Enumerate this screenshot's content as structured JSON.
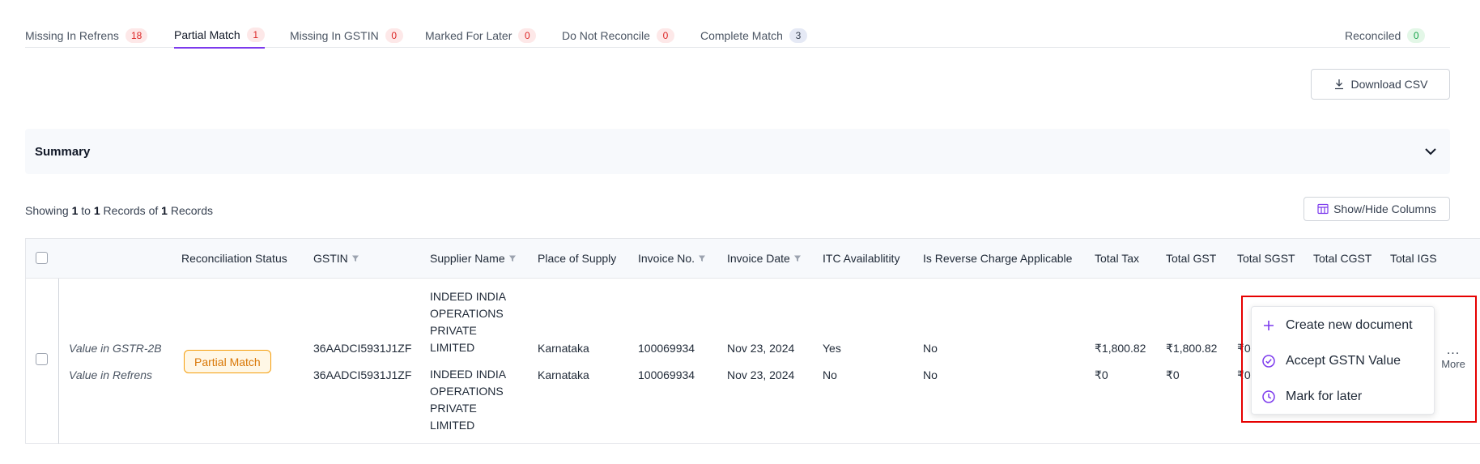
{
  "tabs": [
    {
      "label": "Missing In Refrens",
      "count": "18"
    },
    {
      "label": "Partial Match",
      "count": "1"
    },
    {
      "label": "Missing In GSTIN",
      "count": "0"
    },
    {
      "label": "Marked For Later",
      "count": "0"
    },
    {
      "label": "Do Not Reconcile",
      "count": "0"
    },
    {
      "label": "Complete Match",
      "count": "3"
    }
  ],
  "reconciled": {
    "label": "Reconciled",
    "count": "0"
  },
  "download_label": "Download CSV",
  "summary_title": "Summary",
  "showing": {
    "prefix": "Showing",
    "from": "1",
    "to_word": "to",
    "to": "1",
    "records_word": "Records",
    "of_word": "of",
    "total": "1",
    "records_word2": "Records"
  },
  "show_hide_label": "Show/Hide Columns",
  "columns": {
    "reconciliation_status": "Reconciliation Status",
    "gstin": "GSTIN",
    "supplier_name": "Supplier Name",
    "place_of_supply": "Place of Supply",
    "invoice_no": "Invoice No.",
    "invoice_date": "Invoice Date",
    "itc": "ITC Availablitity",
    "reverse_charge": "Is Reverse Charge Applicable",
    "total_tax": "Total Tax",
    "total_gst": "Total GST",
    "total_sgst": "Total SGST",
    "total_cgst": "Total CGST",
    "total_igst": "Total IGS"
  },
  "row": {
    "status": "Partial Match",
    "gstr": {
      "label": "Value in GSTR-2B",
      "gstin": "36AADCI5931J1ZF",
      "supplier_lines": [
        "INDEED INDIA",
        "OPERATIONS",
        "PRIVATE",
        "LIMITED"
      ],
      "place": "Karnataka",
      "invoice_no": "100069934",
      "invoice_date": "Nov 23, 2024",
      "itc": "Yes",
      "reverse": "No",
      "total_tax": "₹1,800.82",
      "total_gst": "₹1,800.82",
      "total_sgst": "₹0"
    },
    "refrens": {
      "label": "Value in Refrens",
      "gstin": "36AADCI5931J1ZF",
      "supplier_lines": [
        "INDEED INDIA",
        "OPERATIONS",
        "PRIVATE",
        "LIMITED"
      ],
      "place": "Karnataka",
      "invoice_no": "100069934",
      "invoice_date": "Nov 23, 2024",
      "itc": "No",
      "reverse": "No",
      "total_tax": "₹0",
      "total_gst": "₹0",
      "total_sgst": "₹0"
    }
  },
  "more": {
    "dots": "...",
    "label": "More"
  },
  "menu": [
    {
      "label": "Create new document",
      "icon": "plus-icon"
    },
    {
      "label": "Accept GSTN Value",
      "icon": "check-circle-icon"
    },
    {
      "label": "Mark for later",
      "icon": "clock-icon"
    }
  ],
  "colors": {
    "accent": "#7c3aed",
    "highlight": "#e60000",
    "warning": "#d97706"
  }
}
